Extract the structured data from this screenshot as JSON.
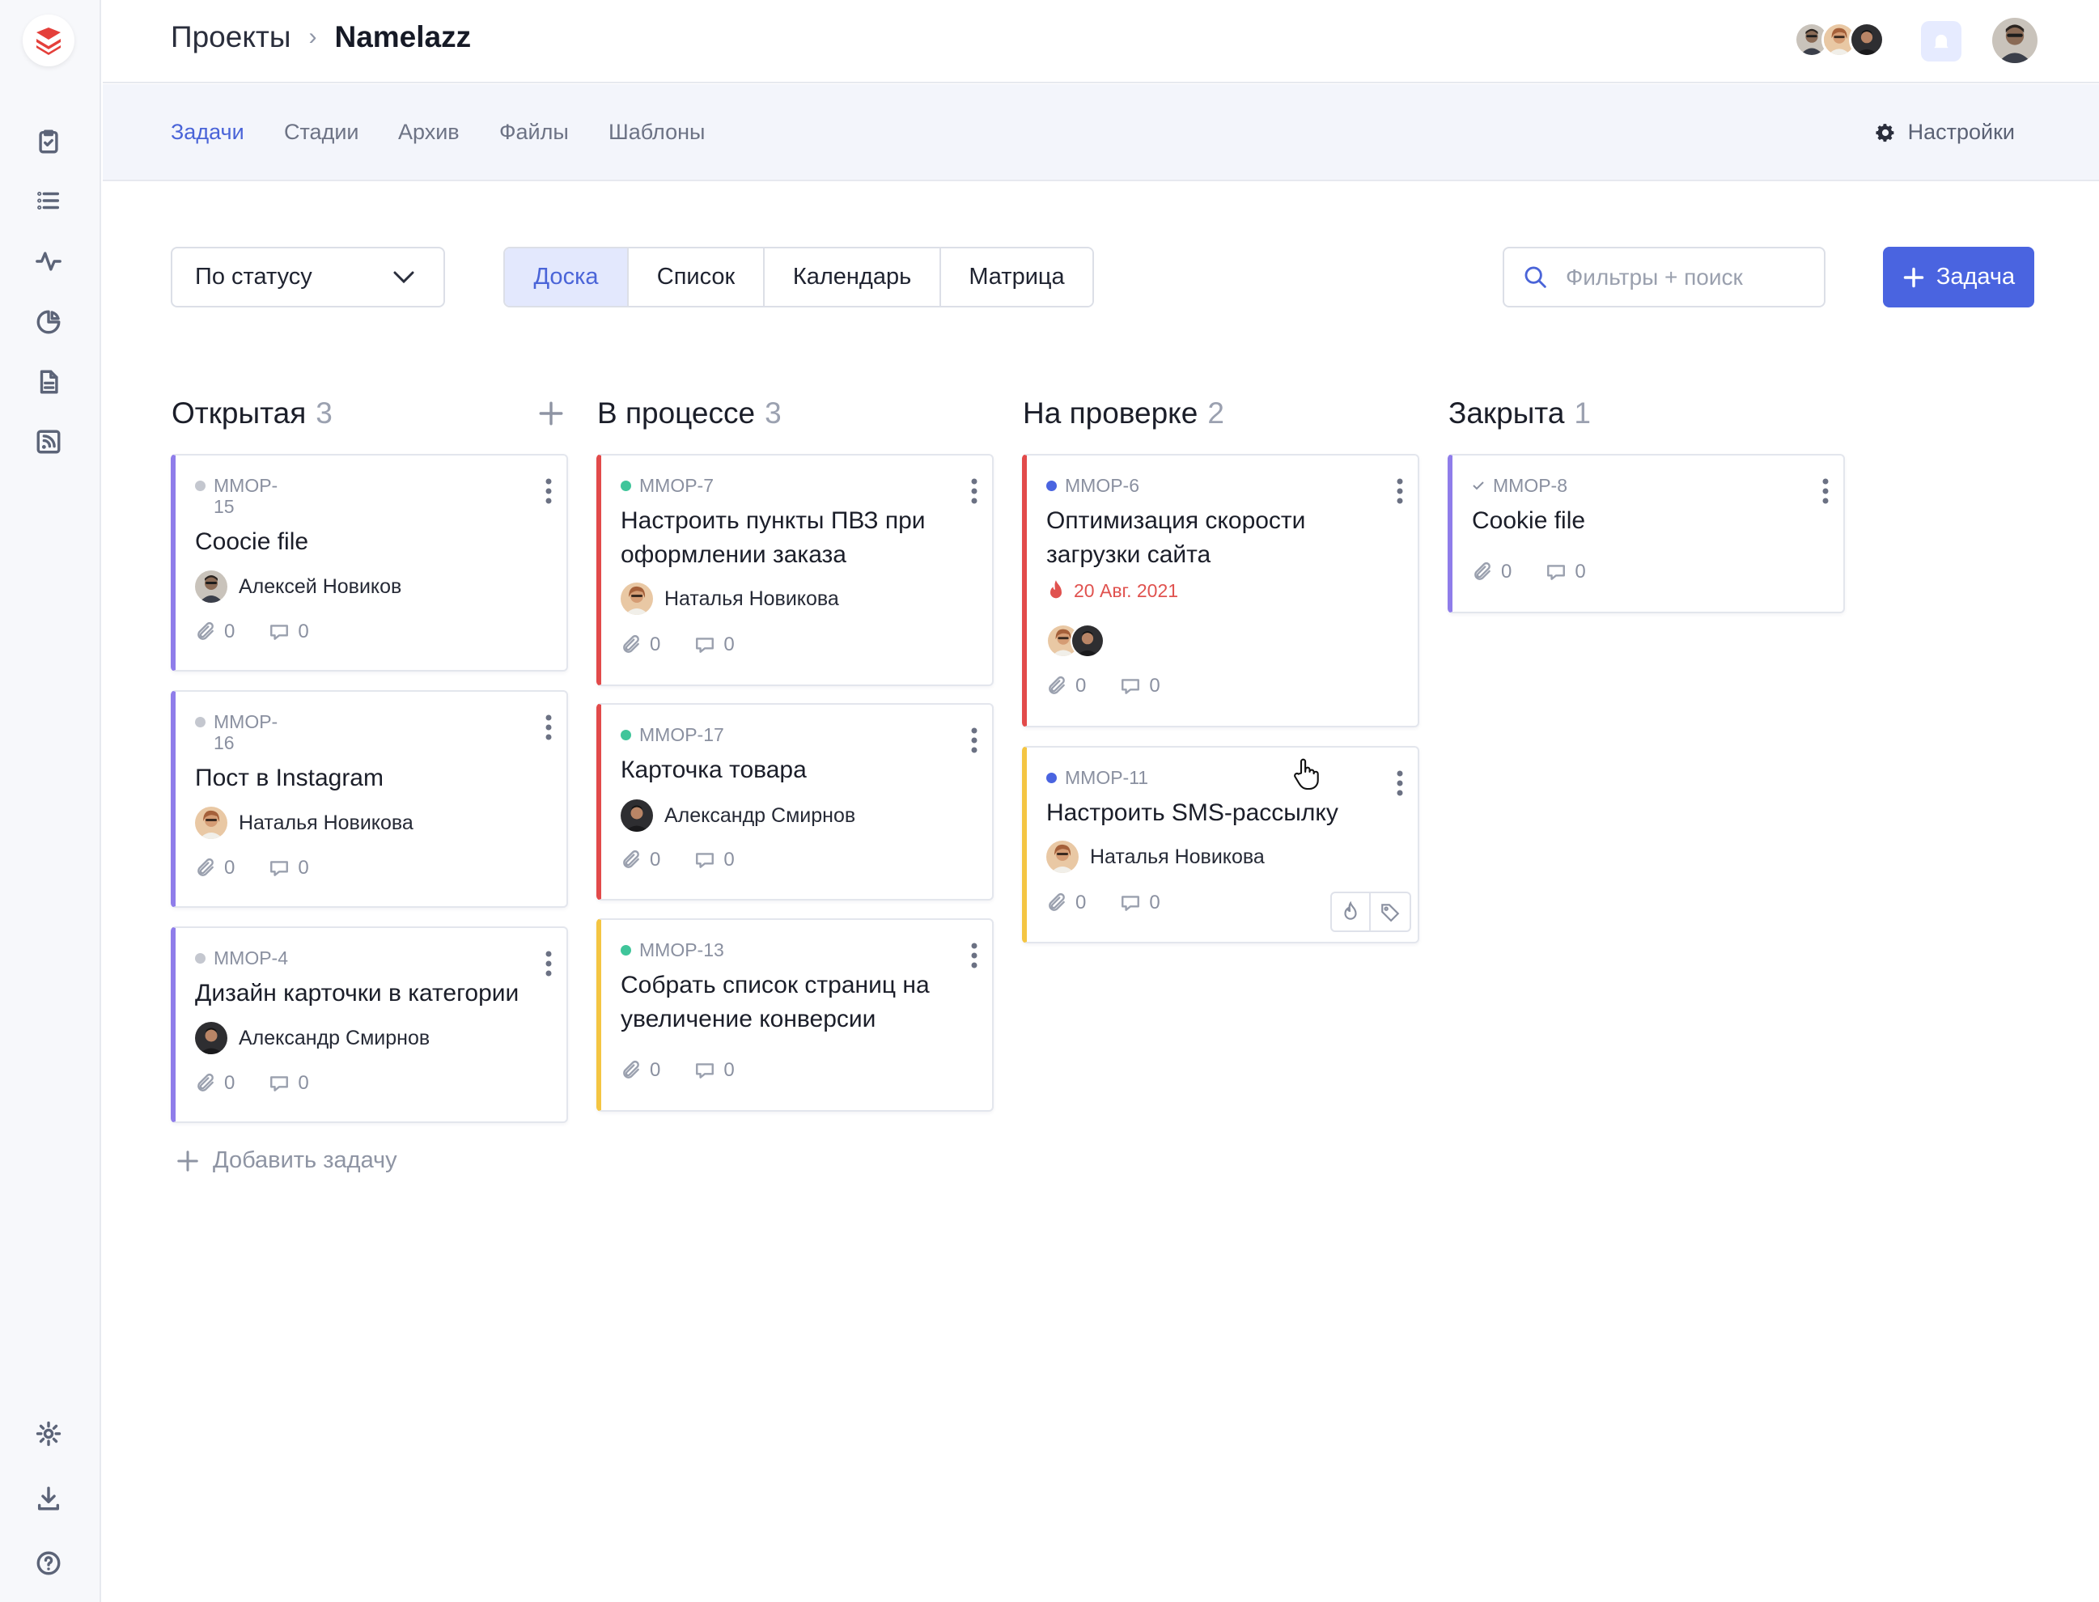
{
  "header": {
    "breadcrumb_root": "Проекты",
    "breadcrumb_separator": "›",
    "project_name": "Namelazz"
  },
  "tabs": [
    "Задачи",
    "Стадии",
    "Архив",
    "Файлы",
    "Шаблоны"
  ],
  "active_tab": "Задачи",
  "settings_label": "Настройки",
  "toolbar": {
    "group_by": "По статусу",
    "views": [
      "Доска",
      "Список",
      "Календарь",
      "Матрица"
    ],
    "active_view": "Доска",
    "search_placeholder": "Фильтры + поиск",
    "add_task_label": "Задача"
  },
  "colors": {
    "accent": "#4a64e0",
    "priority_none": "#8f7dea",
    "priority_high": "#e24a4a",
    "priority_medium": "#f4c542",
    "status_open": "#c4c7cf",
    "status_progress": "#3fc59a",
    "status_review": "#4a64e0",
    "due_alert": "#e0524f"
  },
  "columns": [
    {
      "title": "Открытая",
      "count": "3",
      "add_task_label": "Добавить задачу",
      "cards": [
        {
          "id": "MMOP-15",
          "id_lines": [
            "MMOP-",
            "15"
          ],
          "title": "Coocie file",
          "assignee": "Алексей Новиков",
          "attachments": "0",
          "comments": "0"
        },
        {
          "id": "MMOP-16",
          "id_lines": [
            "MMOP-",
            "16"
          ],
          "title": "Пост в Instagram",
          "assignee": "Наталья Новикова",
          "attachments": "0",
          "comments": "0"
        },
        {
          "id": "MMOP-4",
          "id_lines": [
            "MMOP-4"
          ],
          "title": "Дизайн карточки в категории",
          "assignee": "Александр Смирнов",
          "attachments": "0",
          "comments": "0"
        }
      ]
    },
    {
      "title": "В процессе",
      "count": "3",
      "cards": [
        {
          "id": "MMOP-7",
          "title": "Настроить пункты ПВЗ при оформлении заказа",
          "assignee": "Наталья Новикова",
          "attachments": "0",
          "comments": "0"
        },
        {
          "id": "MMOP-17",
          "title": "Карточка товара",
          "assignee": "Александр Смирнов",
          "attachments": "0",
          "comments": "0"
        },
        {
          "id": "MMOP-13",
          "title": "Собрать список страниц на увеличение конверсии",
          "attachments": "0",
          "comments": "0"
        }
      ]
    },
    {
      "title": "На проверке",
      "count": "2",
      "cards": [
        {
          "id": "MMOP-6",
          "title": "Оптимизация скорости загрузки сайта",
          "due": "20 Авг. 2021",
          "attachments": "0",
          "comments": "0"
        },
        {
          "id": "MMOP-11",
          "title": "Настроить SMS-рассылку",
          "assignee": "Наталья Новикова",
          "attachments": "0",
          "comments": "0"
        }
      ]
    },
    {
      "title": "Закрыта",
      "count": "1",
      "cards": [
        {
          "id": "MMOP-8",
          "title": "Cookie file",
          "attachments": "0",
          "comments": "0"
        }
      ]
    }
  ]
}
